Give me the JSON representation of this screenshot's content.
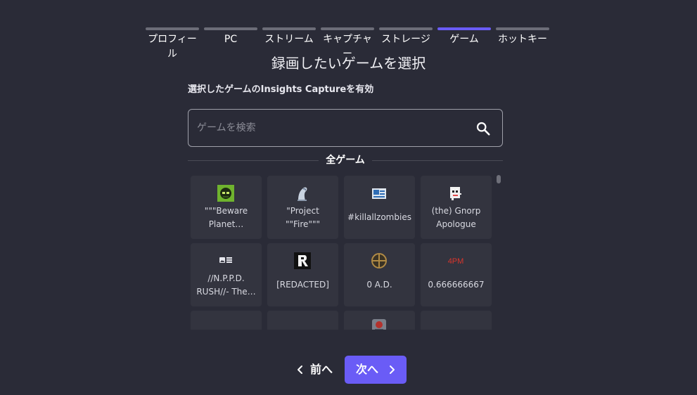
{
  "stepper": {
    "steps": [
      {
        "label": "プロフィール",
        "active": false
      },
      {
        "label": "PC",
        "active": false
      },
      {
        "label": "ストリーム",
        "active": false
      },
      {
        "label": "キャプチャー",
        "active": false
      },
      {
        "label": "ストレージ",
        "active": false
      },
      {
        "label": "ゲーム",
        "active": true
      },
      {
        "label": "ホットキー",
        "active": false
      }
    ]
  },
  "page": {
    "title": "録画したいゲームを選択",
    "subtitle": "選択したゲームのInsights Captureを有効"
  },
  "search": {
    "placeholder": "ゲームを検索",
    "value": "",
    "icon": "search-icon"
  },
  "section": {
    "label": "全ゲーム"
  },
  "games": [
    {
      "name": "\"\"\"Beware Planet…",
      "icon": "beware-planet-icon"
    },
    {
      "name": "\"Project \"\"Fire\"\"\"",
      "icon": "project-fire-icon"
    },
    {
      "name": "#killallzombies",
      "icon": "killallzombies-icon"
    },
    {
      "name": "(the) Gnorp Apologue",
      "icon": "gnorp-icon"
    },
    {
      "name": "//N.P.P.D. RUSH//- The…",
      "icon": "placeholder-image-icon"
    },
    {
      "name": "[REDACTED]",
      "icon": "redacted-icon"
    },
    {
      "name": "0 A.D.",
      "icon": "zero-ad-icon"
    },
    {
      "name": "0.666666667",
      "icon": "4pm-icon",
      "icon_text": "4PM"
    },
    {
      "name": "",
      "icon": "black-square-icon"
    },
    {
      "name": "",
      "icon": "red-circle-icon"
    },
    {
      "name": "",
      "icon": "robot-icon"
    },
    {
      "name": "",
      "icon": "placeholder-image-icon"
    }
  ],
  "nav": {
    "prev_label": "前へ",
    "next_label": "次へ"
  },
  "colors": {
    "background": "#2a2b37",
    "card": "#33343f",
    "accent": "#6a5cf6",
    "step_inactive": "#6c6d78"
  }
}
